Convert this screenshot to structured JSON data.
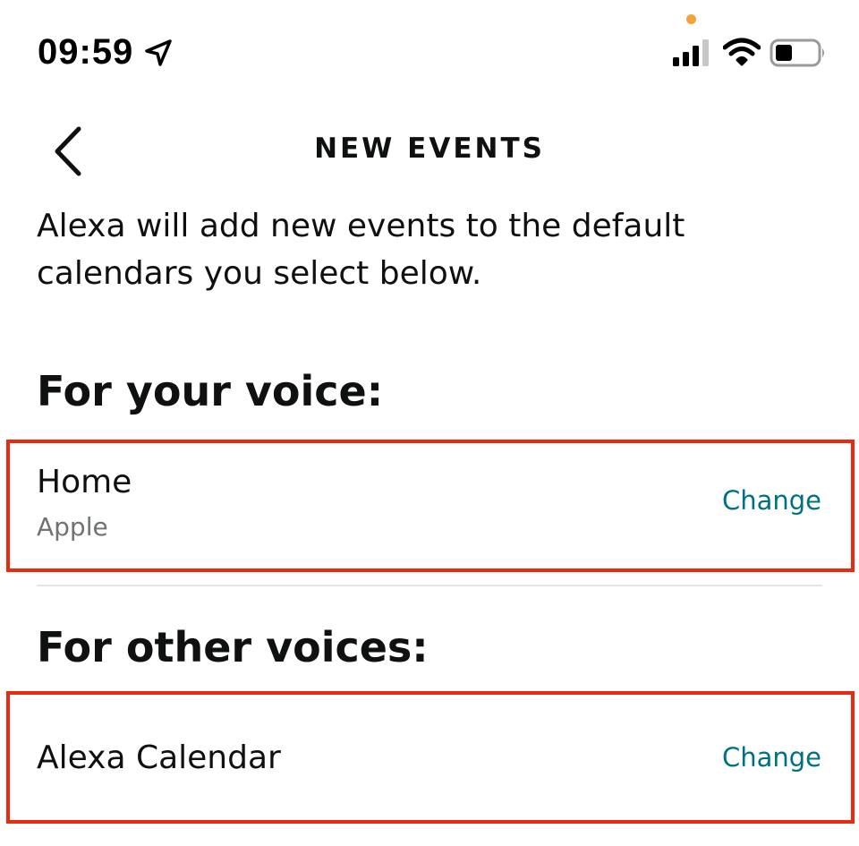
{
  "status_bar": {
    "time": "09:59",
    "icons": [
      "location-arrow-icon",
      "microphone-indicator-dot",
      "cellular-signal-icon",
      "wifi-icon",
      "battery-icon"
    ],
    "mic_dot_color": "#f7a13a",
    "battery_level": 0.4
  },
  "header": {
    "back_icon": "chevron-left-icon",
    "title": "NEW EVENTS"
  },
  "description": "Alexa will add new events to the default calendars you select below.",
  "sections": {
    "your_voice": {
      "heading": "For your voice:",
      "calendar_name": "Home",
      "calendar_provider": "Apple",
      "change_label": "Change"
    },
    "other_voices": {
      "heading": "For other voices:",
      "calendar_name": "Alexa Calendar",
      "change_label": "Change"
    }
  },
  "colors": {
    "link": "#007185",
    "highlight_border": "#ea2a0c",
    "text": "#0f1111",
    "secondary_text": "#6f7373"
  }
}
